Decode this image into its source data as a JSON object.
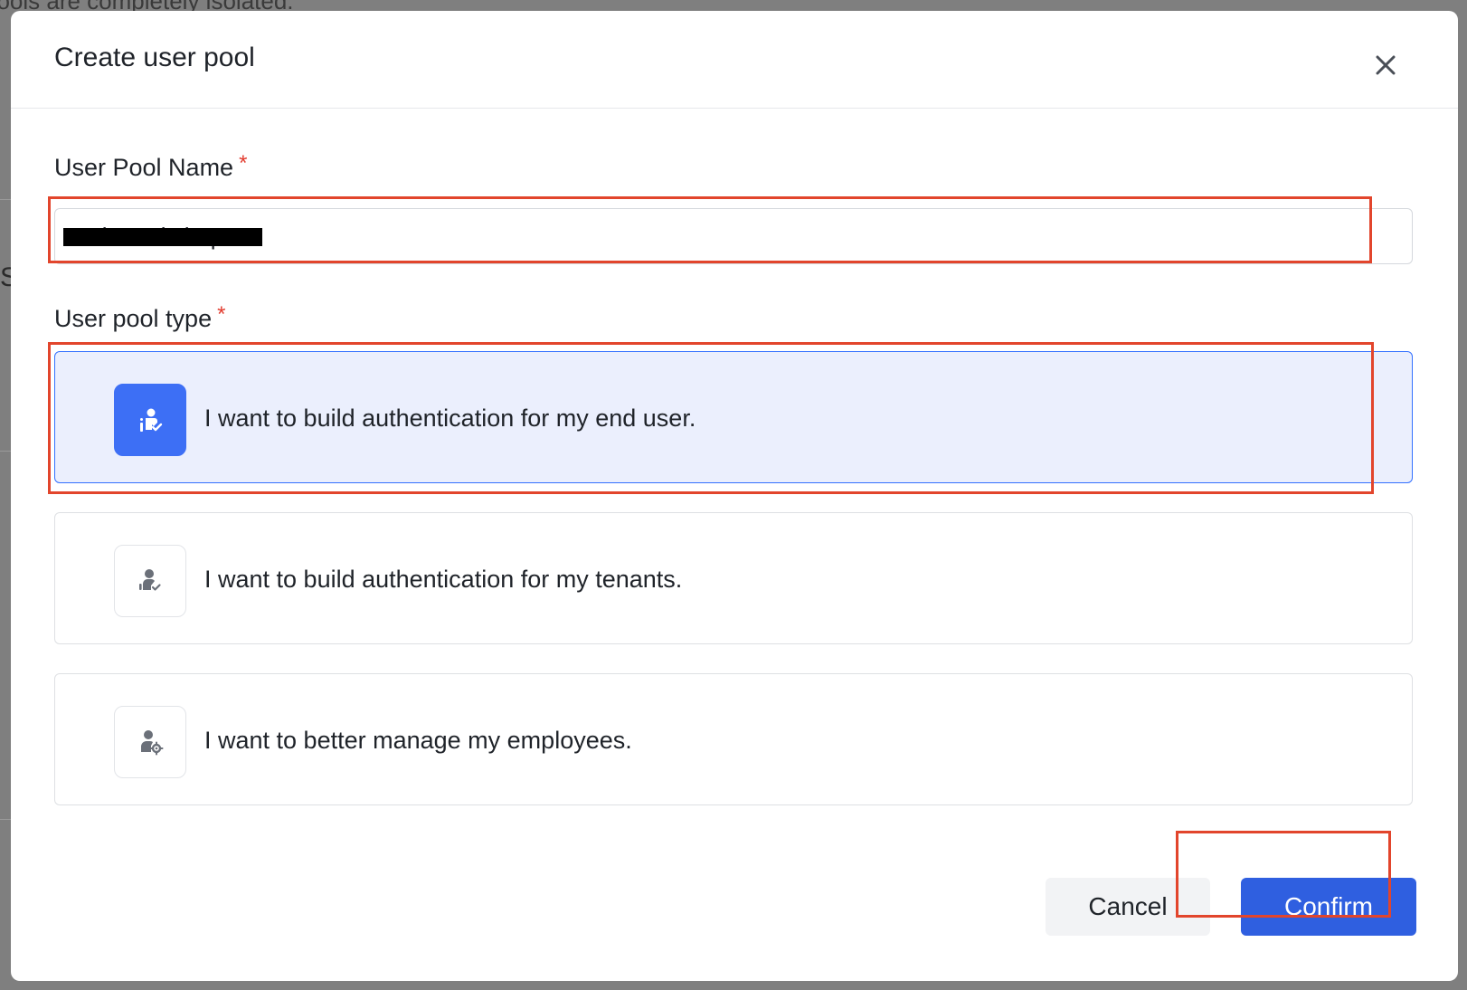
{
  "backdrop": {
    "top_text": "pools are completely isolated.",
    "side_letter": "S"
  },
  "dialog": {
    "title": "Create user pool",
    "close_icon": "close-icon"
  },
  "form": {
    "name_label": "User Pool Name",
    "name_required": "*",
    "name_value": "swb-workshop",
    "type_label": "User pool type",
    "type_required": "*",
    "options": [
      {
        "label": "I want to build authentication for my end user.",
        "icon": "end-user-icon",
        "selected": true
      },
      {
        "label": "I want to build authentication for my tenants.",
        "icon": "tenant-user-icon",
        "selected": false
      },
      {
        "label": "I want to better manage my employees.",
        "icon": "employee-settings-icon",
        "selected": false
      }
    ]
  },
  "footer": {
    "cancel_label": "Cancel",
    "confirm_label": "Confirm"
  },
  "colors": {
    "accent": "#2f5fe0",
    "selected_bg": "#ebeffd",
    "highlight": "#e2452c",
    "required": "#e23b2e"
  }
}
